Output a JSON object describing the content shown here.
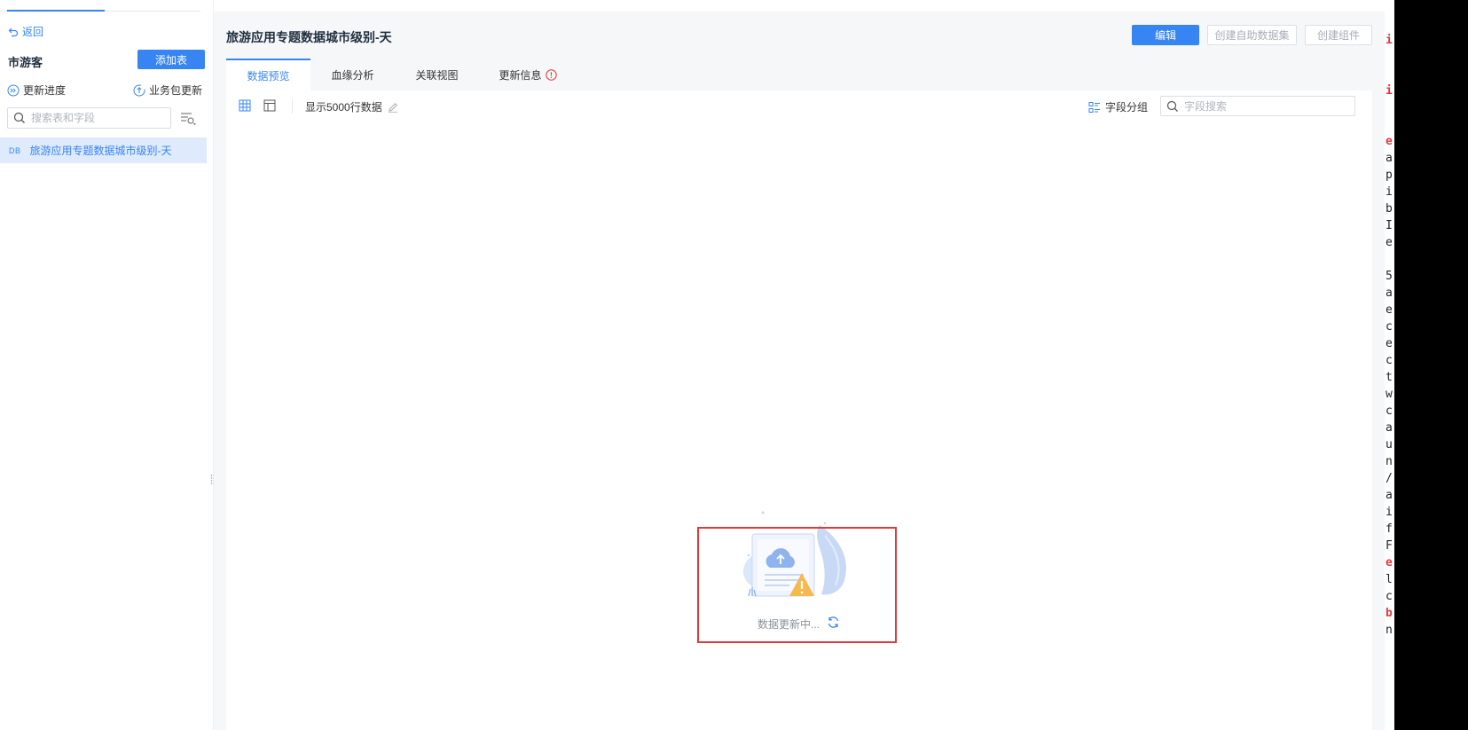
{
  "sidebar": {
    "back_label": "返回",
    "package_title": "市游客",
    "add_table_label": "添加表",
    "update_progress_label": "更新进度",
    "package_update_label": "业务包更新",
    "search_placeholder": "搜索表和字段",
    "table_item": {
      "tag": "DB",
      "label": "旅游应用专题数据城市级别-天"
    }
  },
  "header": {
    "title": "旅游应用专题数据城市级别-天",
    "edit_label": "编辑",
    "create_self_dataset_label": "创建自助数据集",
    "create_component_label": "创建组件"
  },
  "tabs": [
    {
      "label": "数据预览",
      "active": true
    },
    {
      "label": "血缘分析",
      "active": false
    },
    {
      "label": "关联视图",
      "active": false
    },
    {
      "label": "更新信息",
      "active": false
    }
  ],
  "toolbar": {
    "rows_label": "显示5000行数据",
    "field_group_label": "字段分组",
    "field_search_placeholder": "字段搜索"
  },
  "empty_state": {
    "message": "数据更新中..."
  },
  "terminal": {
    "lines": [
      "i",
      "",
      "",
      "i",
      "",
      "",
      "e",
      "a",
      "p",
      "i",
      "b",
      "I",
      "e",
      "",
      "5",
      "a",
      "e",
      "c",
      "e",
      "c",
      "t",
      "w",
      "c",
      "a",
      "u",
      "n",
      "/",
      "a",
      "i",
      "f",
      "F",
      "e",
      "l",
      "c",
      "b",
      "n"
    ],
    "red_lines": [
      0,
      3,
      6,
      31,
      34
    ]
  },
  "colors": {
    "accent": "#3685f2",
    "highlight": "#e03a3a",
    "info_icon": "#e03a3a"
  }
}
